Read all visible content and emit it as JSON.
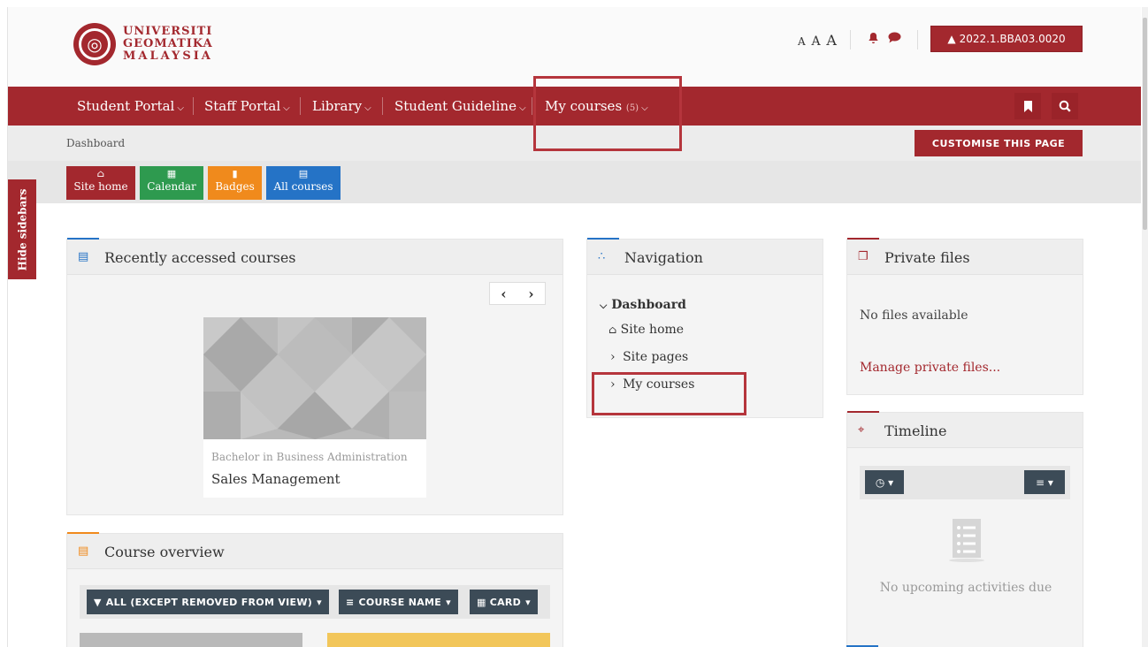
{
  "header": {
    "logo_line1": "UNIVERSITI",
    "logo_line2": "GEOMATIKA",
    "logo_line3": "MALAYSIA",
    "font_size_a1": "A",
    "font_size_a2": "A",
    "font_size_a3": "A",
    "user_label": "2022.1.BBA03.0020"
  },
  "navbar": {
    "items": [
      {
        "label": "Student Portal"
      },
      {
        "label": "Staff Portal"
      },
      {
        "label": "Library"
      },
      {
        "label": "Student Guideline"
      },
      {
        "label": "My courses",
        "count": "(5)"
      }
    ]
  },
  "breadcrumb": {
    "label": "Dashboard"
  },
  "customise_button": "CUSTOMISE THIS PAGE",
  "quick_links": [
    {
      "label": "Site home",
      "color": "#a3282e"
    },
    {
      "label": "Calendar",
      "color": "#2e9a4f"
    },
    {
      "label": "Badges",
      "color": "#f08a1c"
    },
    {
      "label": "All courses",
      "color": "#2573c6"
    }
  ],
  "hide_sidebars": "Hide sidebars",
  "recent_courses": {
    "title": "Recently accessed courses",
    "course_category": "Bachelor in Business Administration",
    "course_name": "Sales Management"
  },
  "course_overview": {
    "title": "Course overview",
    "filter_all": "ALL (EXCEPT REMOVED FROM VIEW)",
    "filter_sort": "COURSE NAME",
    "filter_view": "CARD"
  },
  "navigation": {
    "title": "Navigation",
    "dashboard": "Dashboard",
    "site_home": "Site home",
    "site_pages": "Site pages",
    "my_courses": "My courses"
  },
  "private_files": {
    "title": "Private files",
    "empty": "No files available",
    "manage": "Manage private files..."
  },
  "timeline": {
    "title": "Timeline",
    "empty": "No upcoming activities due"
  },
  "colors": {
    "brand": "#a3282e",
    "dark_button": "#3c4b57"
  }
}
